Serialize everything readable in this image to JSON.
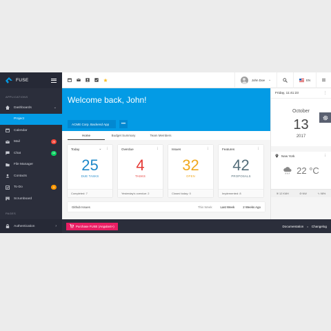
{
  "app": {
    "brand": "FUSE"
  },
  "sidebar": {
    "section_applications": "APPLICATIONS",
    "items": [
      {
        "label": "Dashboards",
        "icon": "home-icon"
      },
      {
        "label": "Project"
      },
      {
        "label": "Calendar",
        "icon": "calendar-icon"
      },
      {
        "label": "Mail",
        "icon": "mail-icon",
        "badge": "25",
        "badge_color": "#f44336"
      },
      {
        "label": "Chat",
        "icon": "chat-icon",
        "badge": "13",
        "badge_color": "#09d261"
      },
      {
        "label": "File Manager",
        "icon": "folder-icon"
      },
      {
        "label": "Contacts",
        "icon": "contacts-icon"
      },
      {
        "label": "To-Do",
        "icon": "todo-icon",
        "badge": "3",
        "badge_color": "#ff9800"
      },
      {
        "label": "Scrumboard",
        "icon": "board-icon"
      }
    ],
    "section_pages": "PAGES",
    "auth_label": "Authentication"
  },
  "topbar": {
    "user_name": "John Doe",
    "language": "EN"
  },
  "hero": {
    "welcome": "Welcome back, John!",
    "project": "ACME Corp. Backend App",
    "more": "•••"
  },
  "tabs": [
    "Home",
    "Budget Summary",
    "Team Members"
  ],
  "widgets": [
    {
      "title": "Today",
      "value": "25",
      "label": "DUE TASKS",
      "color": "#1e88c9",
      "footer_label": "Completed:",
      "footer_value": "7"
    },
    {
      "title": "Overdue",
      "value": "4",
      "label": "TASKS",
      "color": "#e53935",
      "footer_label": "Yesterday's overdue:",
      "footer_value": "2"
    },
    {
      "title": "Issues",
      "value": "32",
      "label": "OPEN",
      "color": "#f0a81e",
      "footer_label": "Closed today:",
      "footer_value": "0"
    },
    {
      "title": "Features",
      "value": "42",
      "label": "PROPOSALS",
      "color": "#546e7a",
      "footer_label": "Implemented:",
      "footer_value": "8"
    }
  ],
  "github": {
    "title": "Github Issues",
    "ranges": [
      "This Week",
      "Last Week",
      "2 Weeks Ago"
    ]
  },
  "right": {
    "datetime": "Friday, 11:41:23",
    "month": "October",
    "day": "13",
    "year": "2017",
    "location": "New York",
    "temp": "22 °C",
    "wind_speed": "12 KMH",
    "wind_dir": "NW",
    "humidity": "98%"
  },
  "footer": {
    "purchase": "Purchase FUSE (Angular4+)",
    "docs": "Documentation",
    "changelog": "Changelog",
    "sep": "•"
  },
  "colors": {
    "accent": "#039be5",
    "sidebar": "#2b2e3b",
    "purchase": "#e91e63"
  }
}
